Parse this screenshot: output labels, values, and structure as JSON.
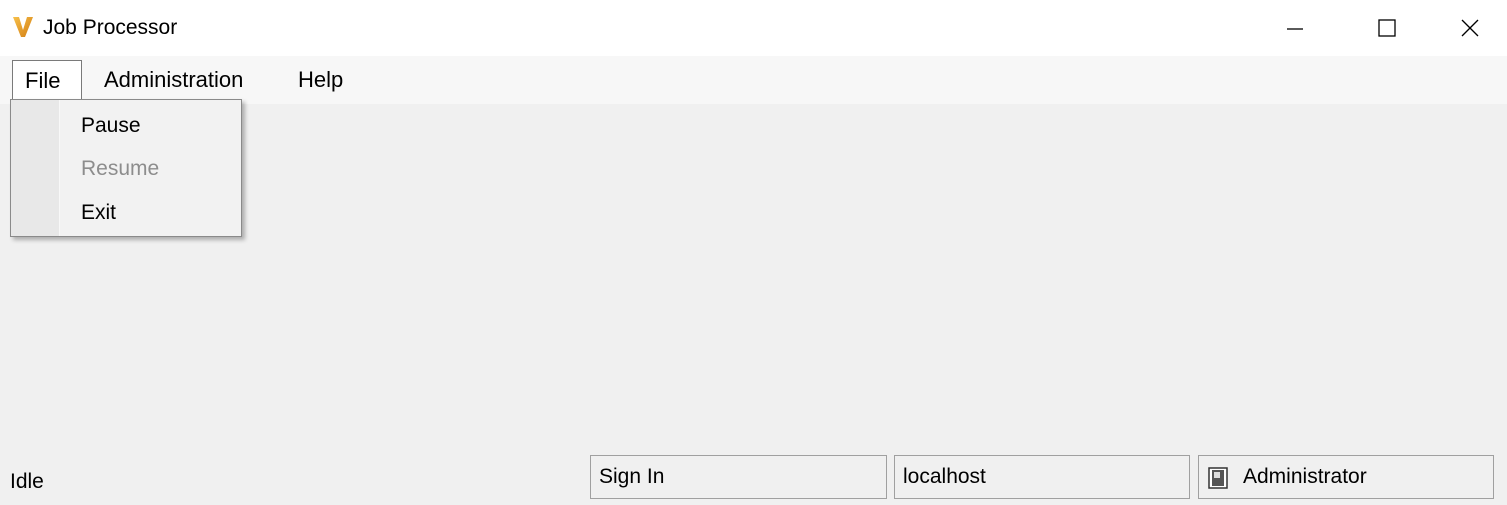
{
  "window": {
    "title": "Job Processor",
    "icon": "vault-v-logo-icon",
    "controls": [
      "minimize-icon",
      "maximize-icon",
      "close-icon"
    ]
  },
  "menubar": {
    "items": [
      {
        "label": "File"
      },
      {
        "label": "Administration"
      },
      {
        "label": "Help"
      }
    ]
  },
  "file_menu": {
    "items": [
      {
        "label": "Pause",
        "enabled": true
      },
      {
        "label": "Resume",
        "enabled": false
      },
      {
        "label": "Exit",
        "enabled": true
      }
    ]
  },
  "statusbar": {
    "state": "Idle",
    "sign_in": "Sign In",
    "server": "localhost",
    "user": "Administrator",
    "user_icon": "user-card-icon"
  },
  "colors": {
    "logo_orange": "#e8a21a",
    "disabled_text": "#8d8d8d"
  }
}
